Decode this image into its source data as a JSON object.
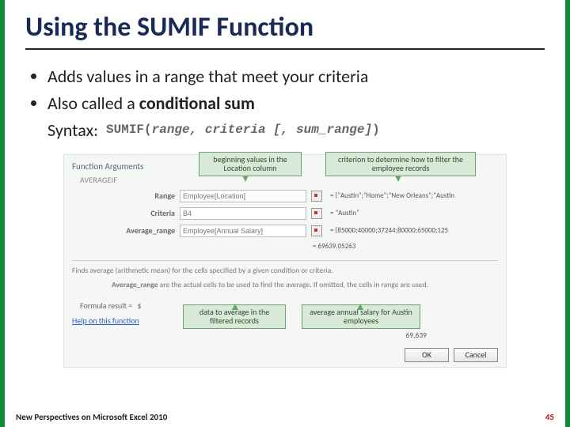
{
  "title": "Using the SUMIF Function",
  "bullets": {
    "b1": "Adds values in a range that meet your criteria",
    "b2_pre": "Also called a ",
    "b2_bold": "conditional sum",
    "b3": "Syntax:"
  },
  "syntax": {
    "fn": "SUMIF(",
    "args": "range, criteria ",
    "opt": "[, sum_range]",
    "close": ")"
  },
  "dialog": {
    "title": "Function Arguments",
    "subtitle": "AVERAGEIF",
    "row1": {
      "label": "Range",
      "value": "Employee[Location]",
      "result": "= {\"Austin\";\"Home\";\"New Orleans\";\"Austin"
    },
    "row2": {
      "label": "Criteria",
      "value": "B4",
      "result": "= \"Austin\""
    },
    "row3": {
      "label": "Average_range",
      "value": "Employee[Annual Salary]",
      "result": "= {85000;40000;37244;80000;65000;125"
    },
    "eq_result": "= 69639.05263",
    "desc": "Finds average (arithmetic mean) for the cells specified by a given condition or criteria.",
    "desc_label": "Average_range",
    "desc_text": "are the actual cells to be used to find the average. If omitted, the cells in range are used.",
    "formula_result_label": "Formula result =",
    "formula_result_value": "$",
    "formula_result_right": "69,639",
    "help": "Help on this function",
    "ok": "OK",
    "cancel": "Cancel"
  },
  "callouts": {
    "c1": "beginning values in the Location column",
    "c2": "criterion to determine how to filter the employee records",
    "c3": "data to average in the filtered records",
    "c4": "average annual salary for Austin employees"
  },
  "footer": {
    "left": "New Perspectives on Microsoft Excel 2010",
    "right": "45"
  }
}
